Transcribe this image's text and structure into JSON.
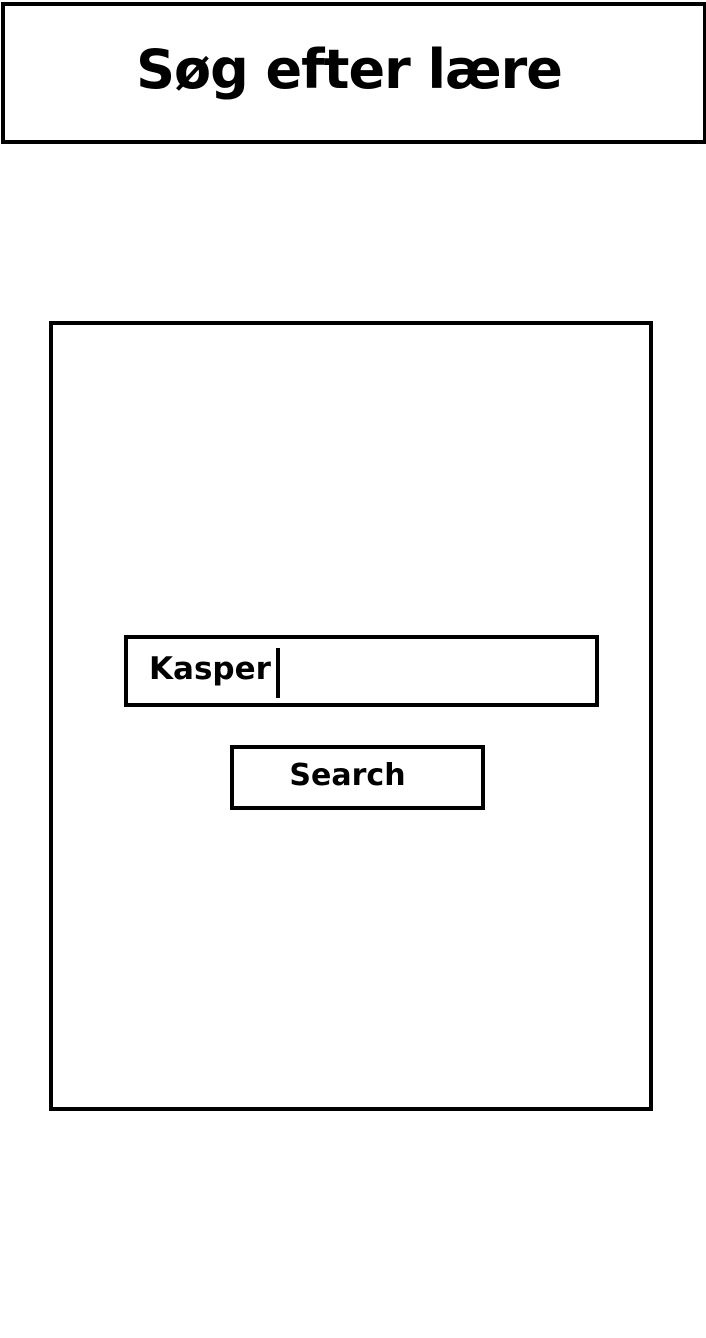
{
  "header": {
    "title": "Søg efter lære"
  },
  "search": {
    "value": "Kasper",
    "button_label": "Search"
  }
}
